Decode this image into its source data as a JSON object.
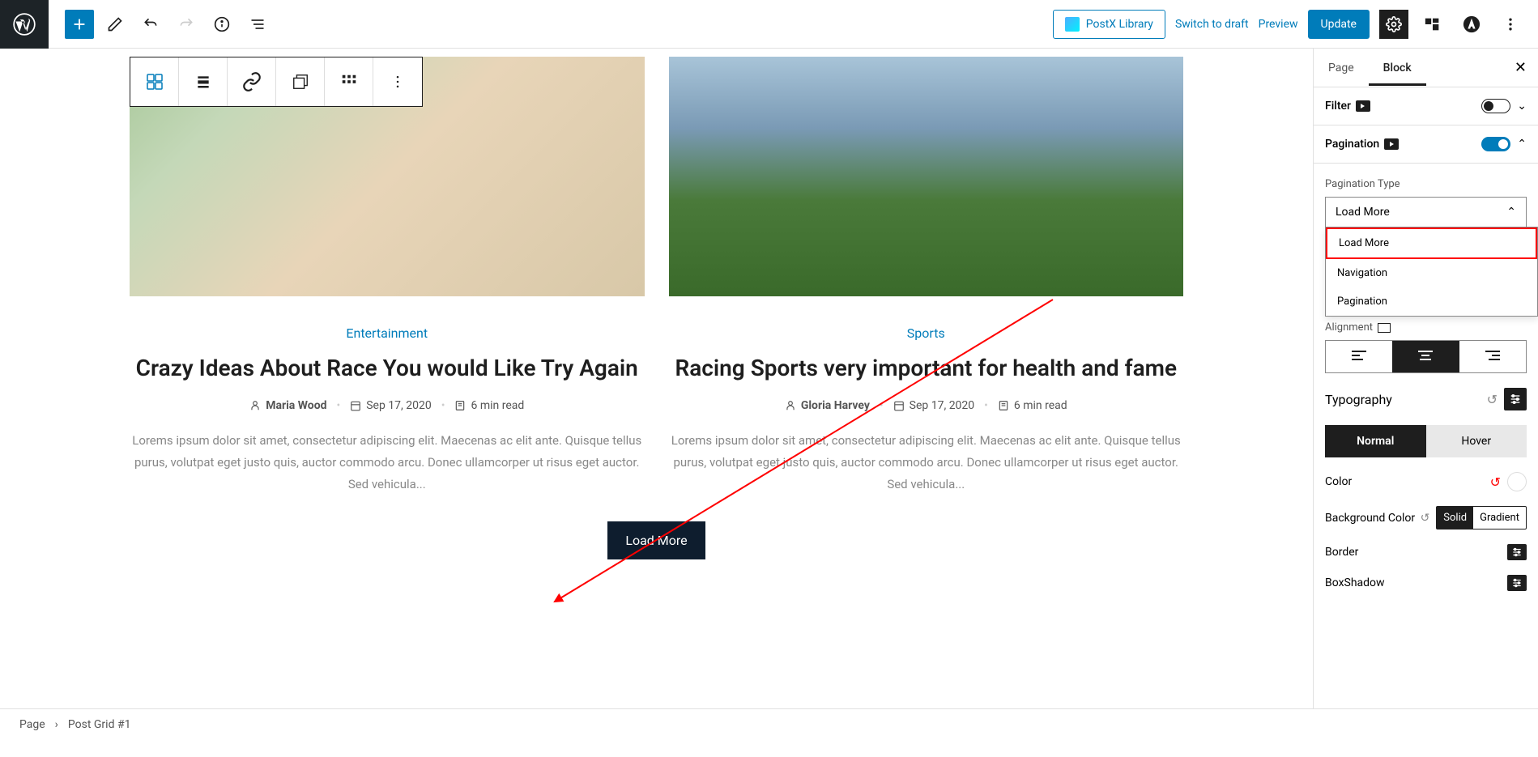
{
  "topbar": {
    "library_label": "PostX Library",
    "draft_label": "Switch to draft",
    "preview_label": "Preview",
    "update_label": "Update"
  },
  "posts": [
    {
      "category": "Entertainment",
      "title": "Crazy Ideas About Race You would Like Try Again",
      "author": "Maria Wood",
      "date": "Sep 17, 2020",
      "read_time": "6 min read",
      "excerpt": "Lorems ipsum dolor sit amet, consectetur adipiscing elit. Maecenas ac elit ante. Quisque tellus purus, volutpat eget justo quis, auctor commodo arcu. Donec ullamcorper ut risus eget auctor. Sed vehicula..."
    },
    {
      "category": "Sports",
      "title": "Racing Sports very important for health and fame",
      "author": "Gloria Harvey",
      "date": "Sep 17, 2020",
      "read_time": "6 min read",
      "excerpt": "Lorems ipsum dolor sit amet, consectetur adipiscing elit. Maecenas ac elit ante. Quisque tellus purus, volutpat eget justo quis, auctor commodo arcu. Donec ullamcorper ut risus eget auctor. Sed vehicula..."
    }
  ],
  "load_more_label": "Load More",
  "sidebar": {
    "tabs": {
      "page": "Page",
      "block": "Block"
    },
    "filter_label": "Filter",
    "pagination_label": "Pagination",
    "pagination_type_label": "Pagination Type",
    "pagination_type_value": "Load More",
    "pagination_options": [
      "Load More",
      "Navigation",
      "Pagination"
    ],
    "alignment_label": "Alignment",
    "typography_label": "Typography",
    "state_normal": "Normal",
    "state_hover": "Hover",
    "color_label": "Color",
    "bg_color_label": "Background Color",
    "bg_solid": "Solid",
    "bg_gradient": "Gradient",
    "border_label": "Border",
    "boxshadow_label": "BoxShadow"
  },
  "breadcrumb": {
    "page": "Page",
    "block": "Post Grid #1"
  }
}
